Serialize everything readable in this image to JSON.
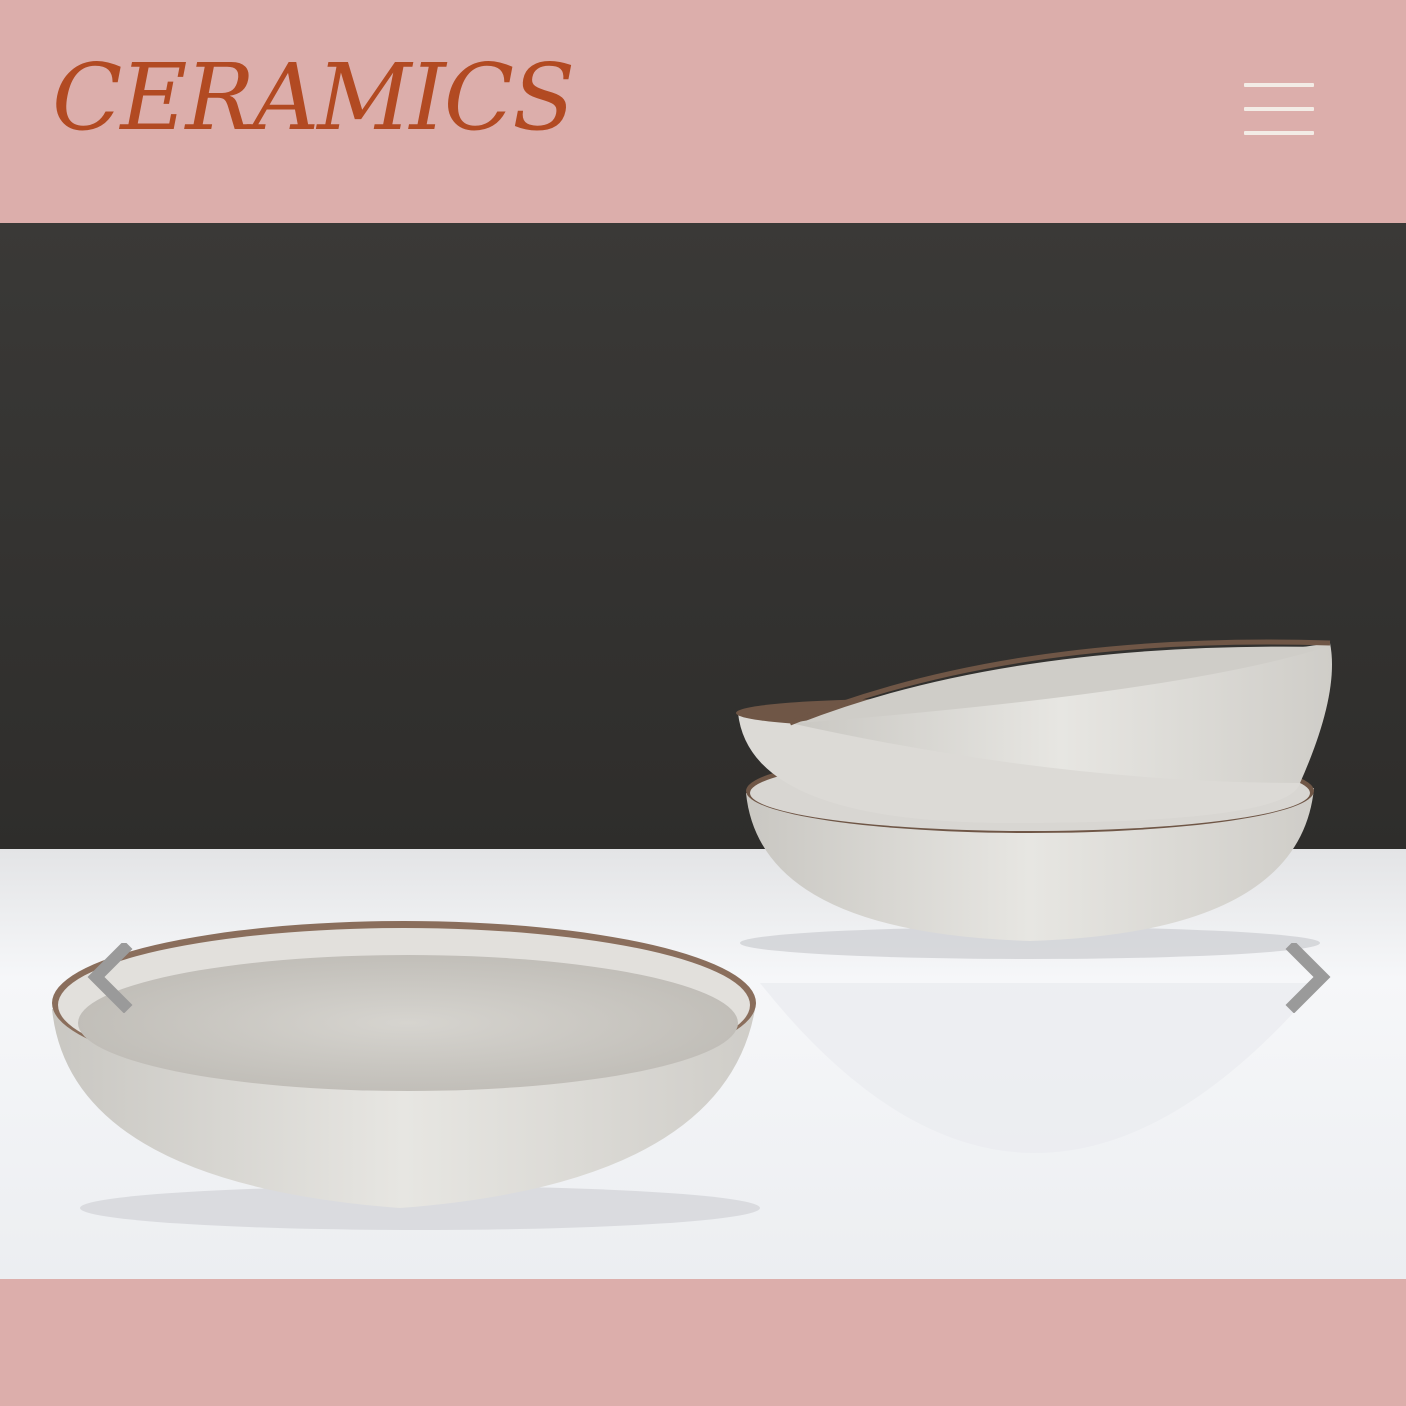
{
  "header": {
    "brand": "CERAMICS",
    "menu_icon": "hamburger-menu-icon"
  },
  "carousel": {
    "slide_image": "ceramic-bowls-photo",
    "prev_icon": "chevron-left-icon",
    "next_icon": "chevron-right-icon"
  },
  "colors": {
    "background": "#dcaeab",
    "brand": "#b24a22",
    "menu_icon": "#f3ece6"
  }
}
